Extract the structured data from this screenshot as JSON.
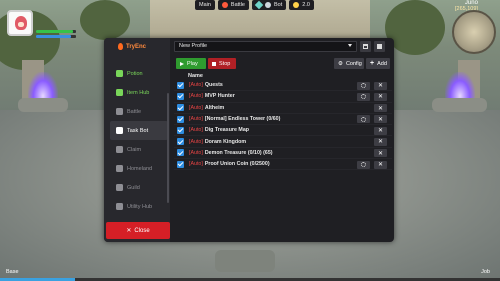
{
  "hud": {
    "main_label": "Main",
    "battle_label": "Battle",
    "bot_label": "Bot",
    "version": "2.0",
    "location": "Juno",
    "coords": "[265,109]",
    "bottom_left": "Base",
    "bottom_right": "Job",
    "hp_fraction": 0.92,
    "sp_fraction": 0.88,
    "exp_fraction": 0.15
  },
  "sidebar": {
    "brand": "TryEnc",
    "items": [
      {
        "label": "Potion",
        "icon": "potion-icon",
        "state": "green"
      },
      {
        "label": "Item Hub",
        "icon": "bag-icon",
        "state": "green"
      },
      {
        "label": "Battle",
        "icon": "sword-icon",
        "state": "normal"
      },
      {
        "label": "Task Bot",
        "icon": "robot-icon",
        "state": "active"
      },
      {
        "label": "Claim",
        "icon": "gift-icon",
        "state": "normal"
      },
      {
        "label": "Homeland",
        "icon": "house-icon",
        "state": "normal"
      },
      {
        "label": "Guild",
        "icon": "shield-icon",
        "state": "normal"
      },
      {
        "label": "Utility Hub",
        "icon": "toolbox-icon",
        "state": "normal"
      },
      {
        "label": "Events",
        "icon": "trophy-icon",
        "state": "normal"
      }
    ],
    "close_label": "Close"
  },
  "toolbar": {
    "profile_value": "New Profile",
    "play_label": "Play",
    "stop_label": "Stop",
    "config_label": "Config",
    "add_label": "Add"
  },
  "table": {
    "header": "Name",
    "rows": [
      {
        "tag": "[Auto]",
        "name": "Quests",
        "has_settings": true
      },
      {
        "tag": "[Auto]",
        "name": "MVP Hunter",
        "has_settings": true
      },
      {
        "tag": "[Auto]",
        "name": "Altheim",
        "has_settings": false
      },
      {
        "tag": "[Auto]",
        "name": "[Normal] Endless Tower (0/60)",
        "has_settings": true
      },
      {
        "tag": "[Auto]",
        "name": "Dig Treasure Map",
        "has_settings": false
      },
      {
        "tag": "[Auto]",
        "name": "Doram Kingdom",
        "has_settings": false
      },
      {
        "tag": "[Auto]",
        "name": "Demon Treasure (0/10) (65)",
        "has_settings": false
      },
      {
        "tag": "[Auto]",
        "name": "Proof Union Coin (0/2500)",
        "has_settings": true
      }
    ]
  },
  "colors": {
    "accent_blue": "#2d8ce0",
    "play_green": "#2f9b2f",
    "stop_red": "#b02025",
    "close_red": "#d51f26",
    "tag_red": "#e84444"
  }
}
